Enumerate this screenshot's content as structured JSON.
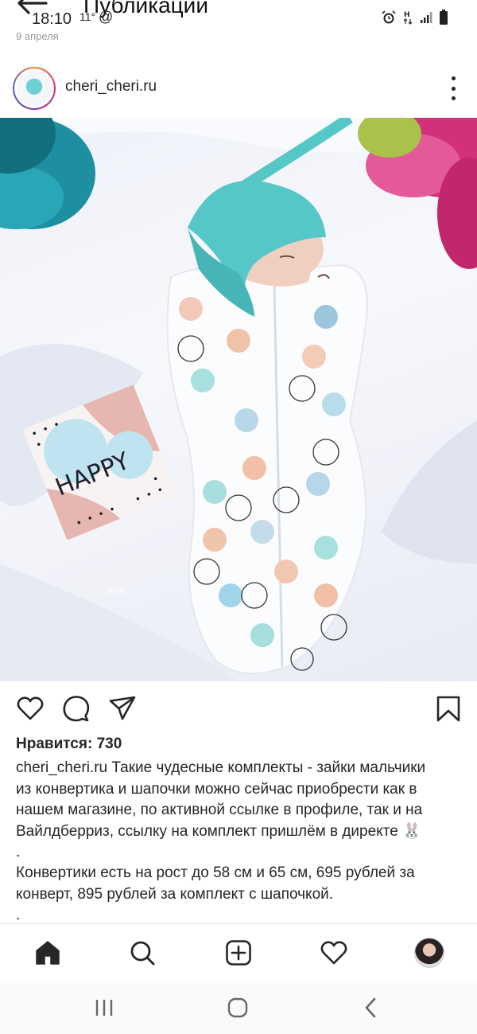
{
  "status_bar": {
    "time": "18:10",
    "temperature": "11°",
    "extra": "@",
    "icons": [
      "alarm-icon",
      "network-icon",
      "signal-icon",
      "battery-icon"
    ]
  },
  "header": {
    "title": "Публикации",
    "date": "9 апреля"
  },
  "post": {
    "username": "cheri_cheri.ru",
    "image_caption": "HAPPY",
    "photo_watermark": "EVA",
    "likes_label": "Нравится: 730",
    "caption_username": "cheri_cheri.ru",
    "caption_lines": [
      " Такие чудесные комплекты - зайки мальчики",
      "из конвертика и шапочки можно сейчас приобрести как в",
      "нашем магазине, по активной ссылке в профиле, так и на",
      "Вайлдберриз, ссылку на комплект пришлём в директе 🐰",
      ".",
      "Конвертики есть на рост до 58 см и 65 см, 695 рублей за",
      "конверт, 895 рублей за комплект с шапочкой.",
      "."
    ]
  },
  "actions": [
    "heart-icon",
    "comment-icon",
    "share-icon",
    "bookmark-icon"
  ],
  "bottom_nav": [
    "home-icon",
    "search-icon",
    "add-post-icon",
    "activity-icon",
    "profile-avatar"
  ],
  "system_nav": [
    "recents-icon",
    "home-circle-icon",
    "back-icon"
  ],
  "colors": {
    "text": "#262626",
    "hat": "#56c7c7",
    "card_pink": "#e6b6b0",
    "card_blue": "#bfe3ef"
  }
}
